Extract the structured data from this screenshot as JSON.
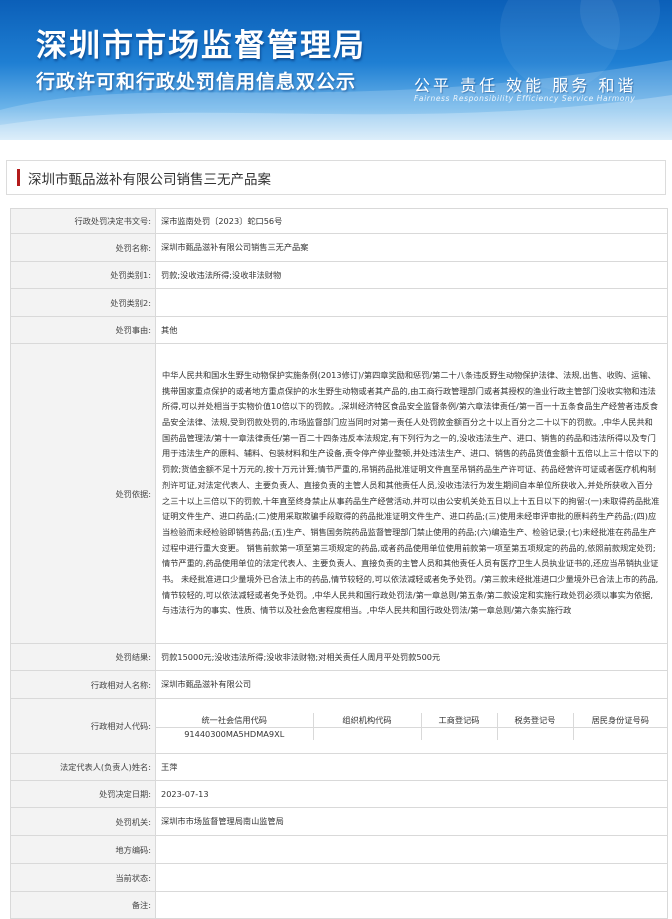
{
  "banner": {
    "title": "深圳市市场监督管理局",
    "subtitle": "行政许可和行政处罚信用信息双公示",
    "slogan": "公平 责任 效能 服务 和谐",
    "slogan_en": "Fairness Responsibility Efficiency Service Harmony"
  },
  "case_title": "深圳市甄品滋补有限公司销售三无产品案",
  "rows": [
    {
      "label": "行政处罚决定书文号:",
      "value": "深市监南处罚〔2023〕蛇口56号"
    },
    {
      "label": "处罚名称:",
      "value": "深圳市甄品滋补有限公司销售三无产品案"
    },
    {
      "label": "处罚类别1:",
      "value": "罚款;没收违法所得;没收非法财物"
    },
    {
      "label": "处罚类别2:",
      "value": ""
    },
    {
      "label": "处罚事由:",
      "value": "其他"
    },
    {
      "label": "处罚依据:",
      "value": "中华人民共和国水生野生动物保护实施条例(2013修订)/第四章奖励和惩罚/第二十八条违反野生动物保护法律、法规,出售、收购、运输、携带国家重点保护的或者地方重点保护的水生野生动物或者其产品的,由工商行政管理部门或者其授权的渔业行政主管部门没收实物和违法所得,可以并处相当于实物价值10倍以下的罚款。,深圳经济特区食品安全监督条例/第六章法律责任/第一百一十五条食品生产经营者违反食品安全法律、法规,受到罚款处罚的,市场监督部门应当同时对第一责任人处罚款金额百分之十以上百分之二十以下的罚款。,中华人民共和国药品管理法/第十一章法律责任/第一百二十四条违反本法规定,有下列行为之一的,没收违法生产、进口、销售的药品和违法所得以及专门用于违法生产的原料、辅料、包装材料和生产设备,责令停产停业整顿,并处违法生产、进口、销售的药品货值金额十五倍以上三十倍以下的罚款;货值金额不足十万元的,按十万元计算;情节严重的,吊销药品批准证明文件直至吊销药品生产许可证、药品经营许可证或者医疗机构制剂许可证,对法定代表人、主要负责人、直接负责的主管人员和其他责任人员,没收违法行为发生期间自本单位所获收入,并处所获收入百分之三十以上三倍以下的罚款,十年直至终身禁止从事药品生产经营活动,并可以由公安机关处五日以上十五日以下的拘留:(一)未取得药品批准证明文件生产、进口药品;(二)使用采取欺骗手段取得的药品批准证明文件生产、进口药品;(三)使用未经审评审批的原料药生产药品;(四)应当检验而未经检验即销售药品;(五)生产、销售国务院药品监督管理部门禁止使用的药品;(六)编造生产、检验记录;(七)未经批准在药品生产过程中进行重大变更。 销售前款第一项至第三项规定的药品,或者药品使用单位使用前款第一项至第五项规定的药品的,依照前款规定处罚;情节严重的,药品使用单位的法定代表人、主要负责人、直接负责的主管人员和其他责任人员有医疗卫生人员执业证书的,还应当吊销执业证书。 未经批准进口少量境外已合法上市的药品,情节较轻的,可以依法减轻或者免予处罚。/第三款未经批准进口少量境外已合法上市的药品,情节较轻的,可以依法减轻或者免予处罚。,中华人民共和国行政处罚法/第一章总则/第五条/第二款设定和实施行政处罚必须以事实为依据,与违法行为的事实、性质、情节以及社会危害程度相当。,中华人民共和国行政处罚法/第一章总则/第六条实施行政"
    },
    {
      "label": "处罚结果:",
      "value": "罚款15000元;没收违法所得;没收非法财物;对相关责任人周月平处罚款500元"
    },
    {
      "label": "行政相对人名称:",
      "value": "深圳市甄品滋补有限公司"
    }
  ],
  "code_table": {
    "label": "行政相对人代码:",
    "headers": [
      "统一社会信用代码",
      "组织机构代码",
      "工商登记码",
      "税务登记号",
      "居民身份证号码"
    ],
    "values": [
      "91440300MA5HDMA9XL",
      "",
      "",
      "",
      ""
    ]
  },
  "rows2": [
    {
      "label": "法定代表人(负责人)姓名:",
      "value": "王萍"
    },
    {
      "label": "处罚决定日期:",
      "value": "2023-07-13"
    },
    {
      "label": "处罚机关:",
      "value": "深圳市市场监督管理局南山监管局"
    },
    {
      "label": "地方编码:",
      "value": ""
    },
    {
      "label": "当前状态:",
      "value": ""
    },
    {
      "label": "备注:",
      "value": ""
    }
  ],
  "colors": {
    "accent_bar": "#b31b1b",
    "banner_blue": "#1f7fd3",
    "label_bg": "#f3f3f3"
  }
}
